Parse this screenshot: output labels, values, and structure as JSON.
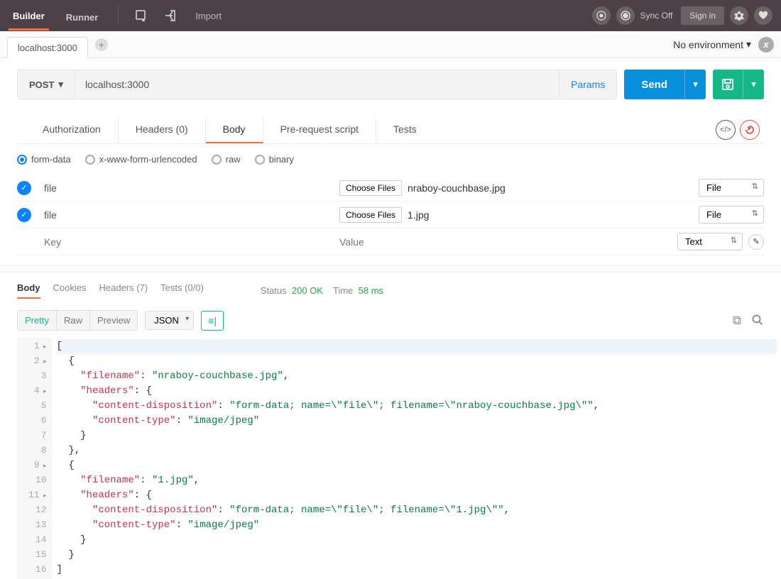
{
  "toolbar": {
    "builder": "Builder",
    "runner": "Runner",
    "import": "Import",
    "sync": "Sync Off",
    "signin": "Sign in"
  },
  "tabrow": {
    "tab1": "localhost:3000",
    "environment": "No environment"
  },
  "request": {
    "method": "POST",
    "url": "localhost:3000",
    "params": "Params",
    "send": "Send"
  },
  "reqtabs": {
    "auth": "Authorization",
    "headers": "Headers (0)",
    "body": "Body",
    "prereq": "Pre-request script",
    "tests": "Tests"
  },
  "bodytypes": {
    "formdata": "form-data",
    "urlenc": "x-www-form-urlencoded",
    "raw": "raw",
    "binary": "binary"
  },
  "formdata": {
    "rows": [
      {
        "key": "file",
        "choose": "Choose Files",
        "filename": "nraboy-couchbase.jpg",
        "type": "File"
      },
      {
        "key": "file",
        "choose": "Choose Files",
        "filename": "1.jpg",
        "type": "File"
      }
    ],
    "key_placeholder": "Key",
    "value_placeholder": "Value",
    "type_empty": "Text"
  },
  "response": {
    "tabs": {
      "body": "Body",
      "cookies": "Cookies",
      "headers": "Headers (7)",
      "tests": "Tests (0/0)"
    },
    "status_label": "Status",
    "status_value": "200 OK",
    "time_label": "Time",
    "time_value": "58 ms",
    "views": {
      "pretty": "Pretty",
      "raw": "Raw",
      "preview": "Preview"
    },
    "format": "JSON"
  },
  "code": {
    "lines": [
      {
        "n": "1",
        "fold": true,
        "html": "["
      },
      {
        "n": "2",
        "fold": true,
        "html": "  {"
      },
      {
        "n": "3",
        "fold": false,
        "html": "    \"filename\": \"nraboy-couchbase.jpg\","
      },
      {
        "n": "4",
        "fold": true,
        "html": "    \"headers\": {"
      },
      {
        "n": "5",
        "fold": false,
        "html": "      \"content-disposition\": \"form-data; name=\\\"file\\\"; filename=\\\"nraboy-couchbase.jpg\\\"\","
      },
      {
        "n": "6",
        "fold": false,
        "html": "      \"content-type\": \"image/jpeg\""
      },
      {
        "n": "7",
        "fold": false,
        "html": "    }"
      },
      {
        "n": "8",
        "fold": false,
        "html": "  },"
      },
      {
        "n": "9",
        "fold": true,
        "html": "  {"
      },
      {
        "n": "10",
        "fold": false,
        "html": "    \"filename\": \"1.jpg\","
      },
      {
        "n": "11",
        "fold": true,
        "html": "    \"headers\": {"
      },
      {
        "n": "12",
        "fold": false,
        "html": "      \"content-disposition\": \"form-data; name=\\\"file\\\"; filename=\\\"1.jpg\\\"\","
      },
      {
        "n": "13",
        "fold": false,
        "html": "      \"content-type\": \"image/jpeg\""
      },
      {
        "n": "14",
        "fold": false,
        "html": "    }"
      },
      {
        "n": "15",
        "fold": false,
        "html": "  }"
      },
      {
        "n": "16",
        "fold": false,
        "html": "]"
      }
    ]
  }
}
